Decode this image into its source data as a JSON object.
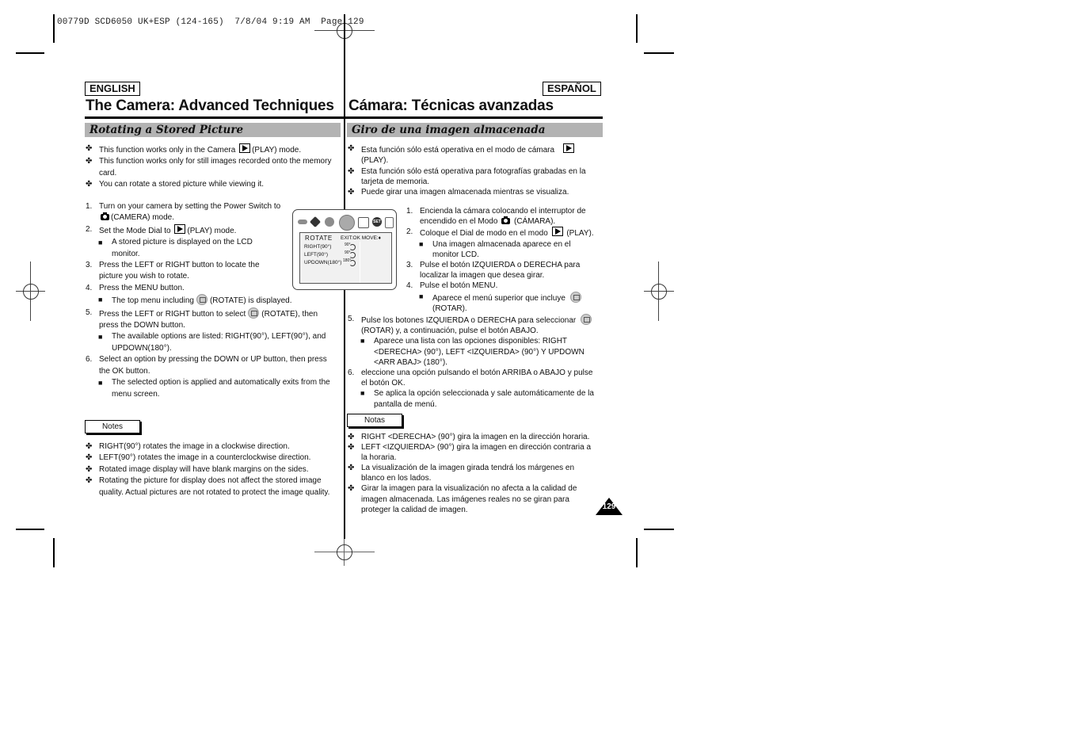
{
  "slug": "00779D SCD6050 UK+ESP (124-165)  7/8/04 9:19 AM  Page 129",
  "page_number": "129",
  "english": {
    "lang_label": "ENGLISH",
    "title": "The Camera: Advanced Techniques",
    "section": "Rotating a Stored Picture",
    "intro": [
      {
        "pre": "This function works only in the Camera",
        "icon": "play-icon",
        "post": "(PLAY) mode."
      },
      {
        "pre": "This function works only for still images recorded onto the memory",
        "line2": "card."
      },
      {
        "pre": "You can rotate a stored picture while viewing it."
      }
    ],
    "steps": {
      "s1a": "1.",
      "s1": "Turn on your camera by setting the Power Switch to",
      "s1b": "(CAMERA) mode.",
      "s2a": "2.",
      "s2": "Set the Mode Dial to",
      "s2b": "(PLAY) mode.",
      "s2_sub1": "A stored picture is displayed on the LCD",
      "s2_sub2": "monitor.",
      "s3a": "3.",
      "s3": "Press the LEFT or RIGHT button to locate the",
      "s3b": "picture you wish to rotate.",
      "s4a": "4.",
      "s4": "Press the MENU button.",
      "s4_sub_pre": "The top menu including",
      "s4_sub_post": "(ROTATE) is displayed.",
      "s5a": "5.",
      "s5_pre": "Press the LEFT or RIGHT button to select",
      "s5_post": "(ROTATE), then",
      "s5b": "press the DOWN button.",
      "s5_sub1": "The available options are listed: RIGHT(90°), LEFT(90°), and",
      "s5_sub2": "UPDOWN(180°).",
      "s6a": "6.",
      "s6": "Select an option by pressing the DOWN or UP button, then press",
      "s6b": "the OK button.",
      "s6_sub1": "The selected option is applied and automatically exits from the",
      "s6_sub2": "menu screen."
    },
    "notes_label": "Notes",
    "notes": [
      "RIGHT(90°) rotates the image in a clockwise direction.",
      "LEFT(90°) rotates the image in a counterclockwise direction.",
      "Rotated image display will have blank margins on the sides.",
      "Rotating the picture for display does not affect the stored image",
      "quality. Actual pictures are not rotated to protect the image quality."
    ]
  },
  "lcd": {
    "menu_title": "ROTATE",
    "hint": "EXIT:OK  MOVE:♦",
    "options": [
      {
        "label": "RIGHT(90°)",
        "deg": "90°"
      },
      {
        "label": "LEFT(90°)",
        "deg": "90°"
      },
      {
        "label": "UPDOWN(180°)",
        "deg": "180°"
      }
    ],
    "top_icons": [
      "back-icon",
      "mode-icon",
      "slideshow-icon",
      "rotate-icon",
      "print-icon",
      "set-icon",
      "protect-icon"
    ],
    "set_label": "SET"
  },
  "spanish": {
    "lang_label": "ESPAÑOL",
    "title": "Cámara: Técnicas avanzadas",
    "section": "Giro de una imagen almacenada",
    "intro": {
      "i1": "Esta función sólo está operativa en el modo de cámara",
      "i1b": "(PLAY).",
      "i2": "Esta función sólo está operativa para fotografías grabadas en la",
      "i2b": "tarjeta de memoria.",
      "i3": "Puede girar una imagen almacenada mientras se visualiza."
    },
    "steps": {
      "s1": "Encienda la cámara colocando el interruptor de",
      "s1b_pre": "encendido en el Modo",
      "s1b_post": "(CÁMARA).",
      "s2_pre": "Coloque el Dial de modo en el modo",
      "s2_post": "(PLAY).",
      "s2_sub1": "Una imagen almacenada aparece en el",
      "s2_sub2": "monitor LCD.",
      "s3": "Pulse el botón IZQUIERDA o DERECHA para",
      "s3b": "localizar la imagen que desea girar.",
      "s4": "Pulse el botón MENU.",
      "s4_sub1": "Aparece el menú superior que incluye",
      "s4_sub2": "(ROTAR).",
      "s5": "Pulse los botones IZQUIERDA o DERECHA para seleccionar",
      "s5b": "(ROTAR) y, a continuación, pulse el botón ABAJO.",
      "s5_sub1": "Aparece una lista con las opciones disponibles: RIGHT",
      "s5_sub2": "<DERECHA> (90°), LEFT <IZQUIERDA> (90°) Y UPDOWN",
      "s5_sub3": "<ARR ABAJ> (180°).",
      "s6": "eleccione una opción pulsando el botón ARRIBA o ABAJO y pulse",
      "s6b": "el botón OK.",
      "s6_sub1": "Se aplica la opción seleccionada y sale automáticamente de la",
      "s6_sub2": "pantalla de menú."
    },
    "notes_label": "Notas",
    "notes": {
      "n1": "RIGHT <DERECHA> (90°) gira la imagen en la dirección horaria.",
      "n2": "LEFT <IZQUIERDA> (90°) gira la imagen en dirección contraria a",
      "n2b": "la horaria.",
      "n3": "La visualización de la imagen girada tendrá los márgenes en",
      "n3b": "blanco en los lados.",
      "n4": "Girar la imagen para la visualización no afecta a la calidad de",
      "n4b": "imagen almacenada. Las imágenes reales no se giran para",
      "n4c": "proteger la calidad de imagen."
    }
  },
  "markers": {
    "bullet": "✤",
    "square": "■"
  }
}
